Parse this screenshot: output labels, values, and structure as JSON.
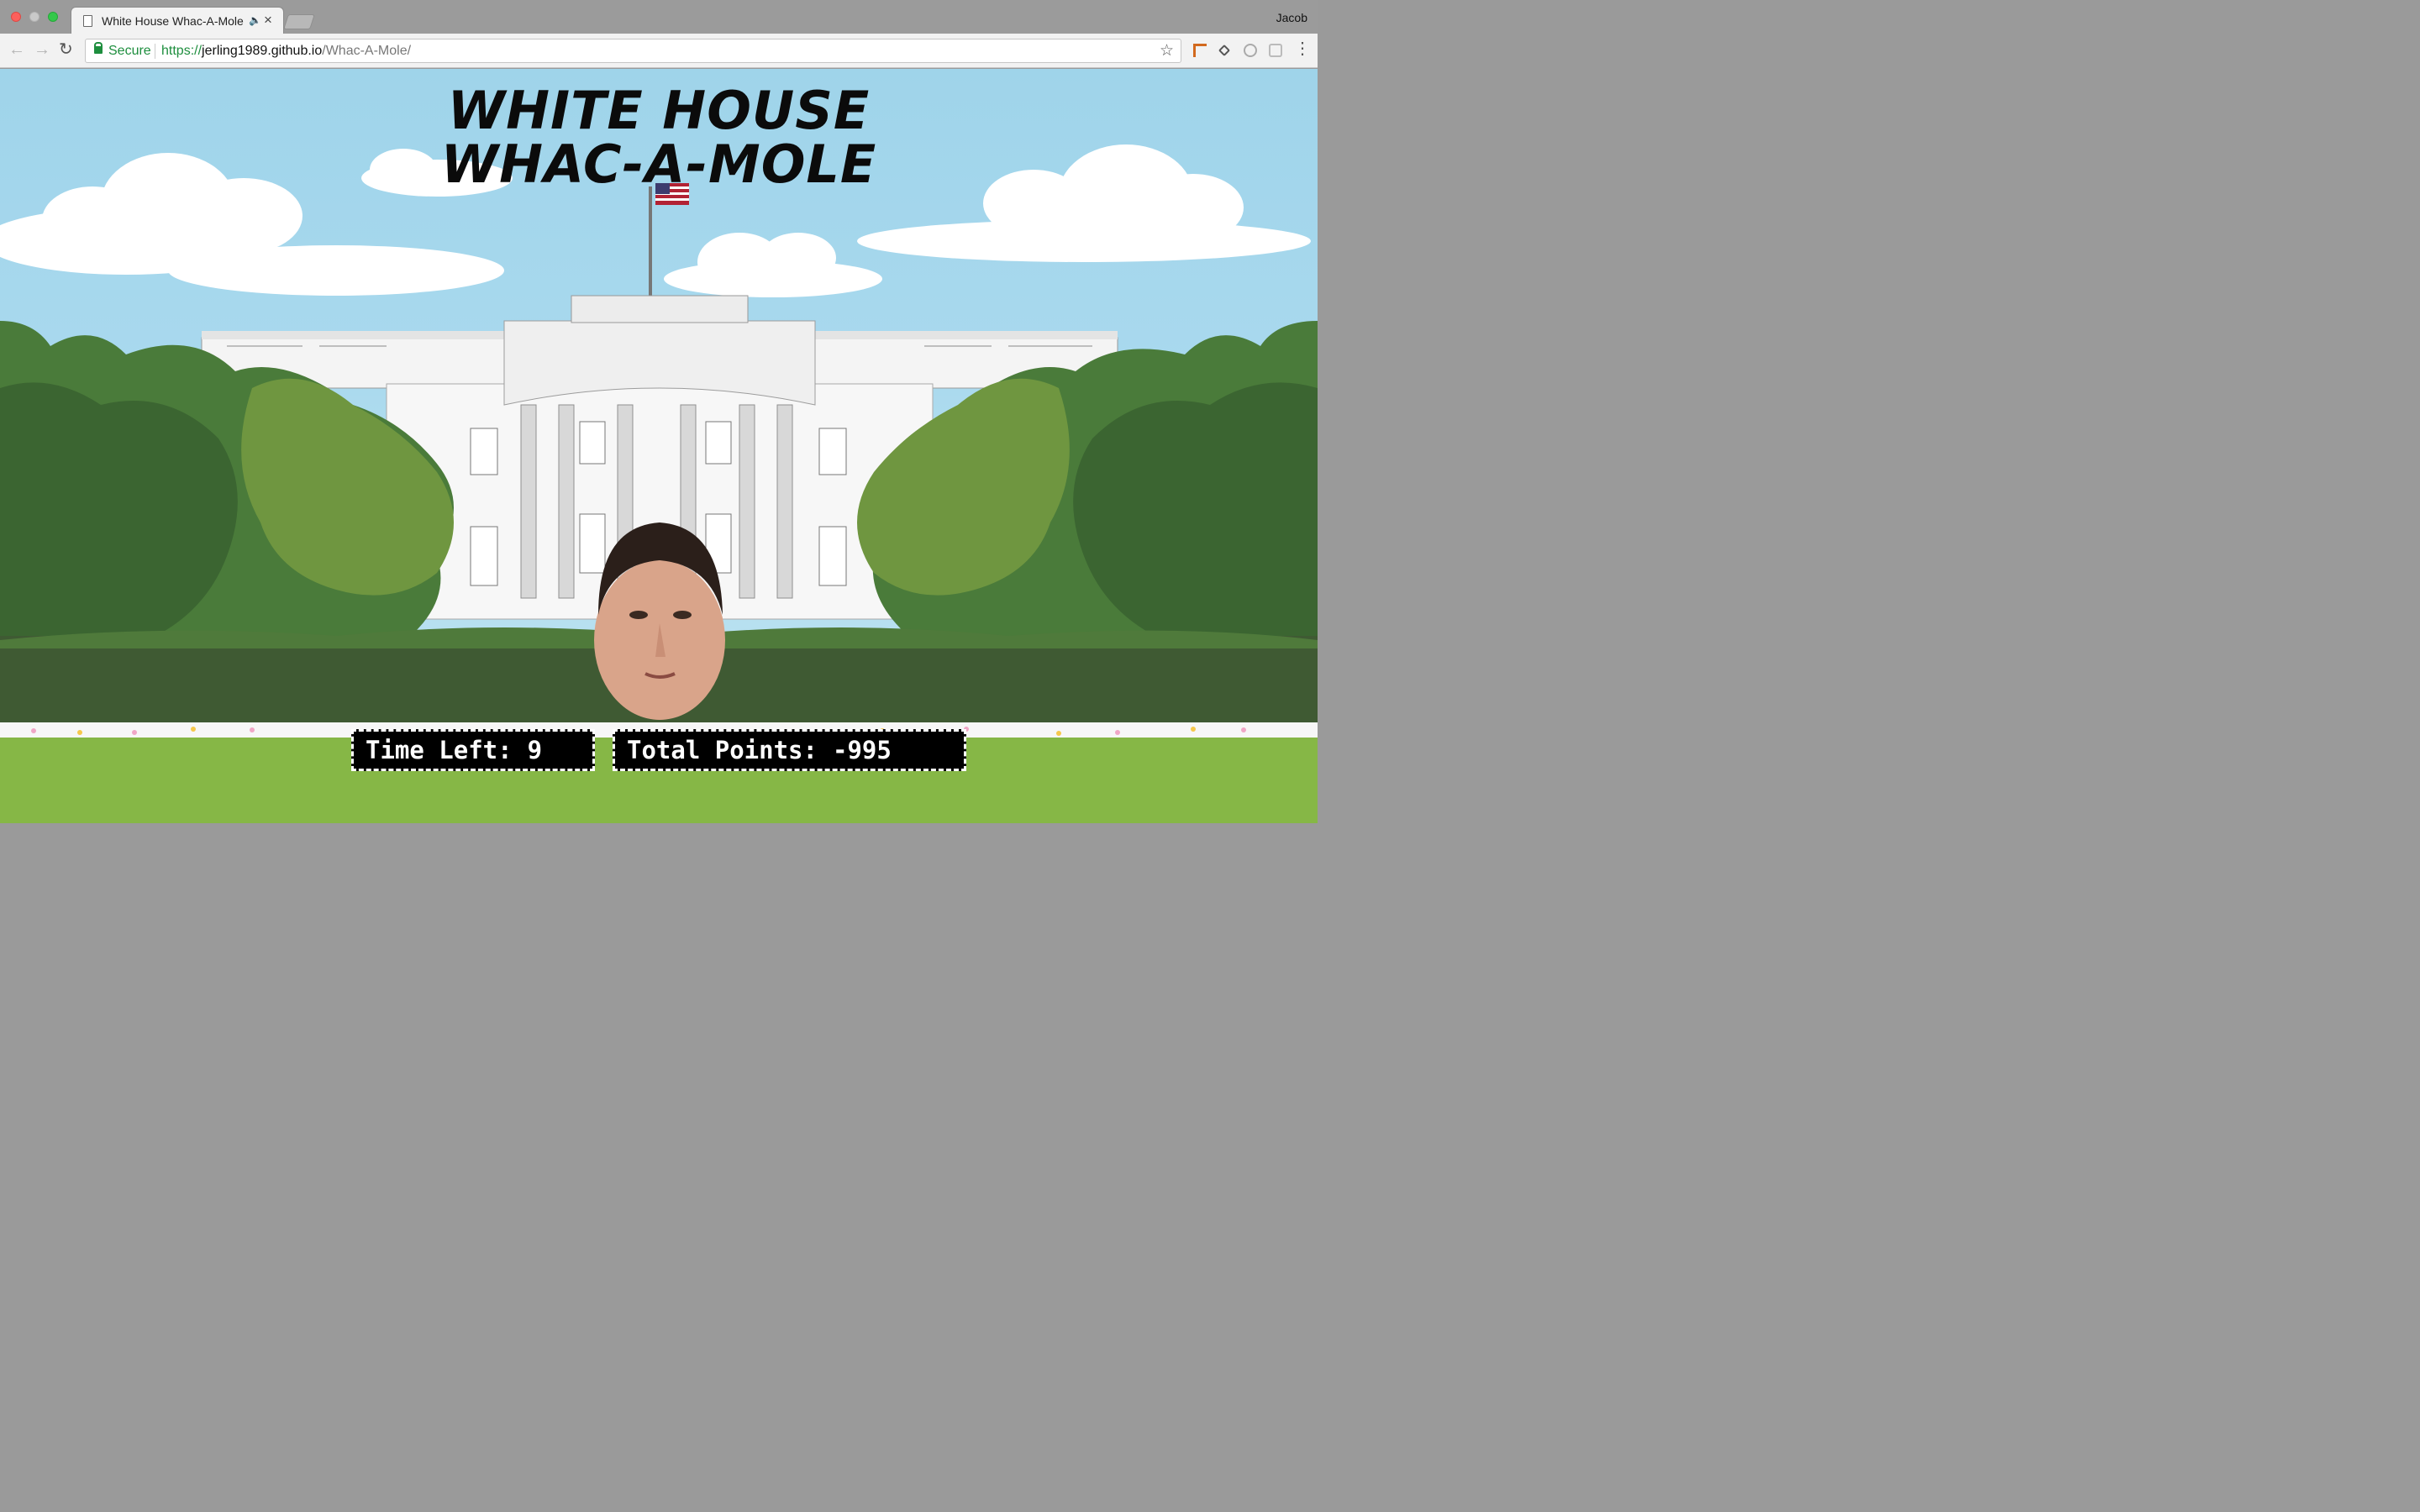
{
  "browser": {
    "tab_title": "White House Whac-A-Mole",
    "profile_name": "Jacob",
    "secure_label": "Secure",
    "url_scheme": "https://",
    "url_host": "jerling1989.github.io",
    "url_path": "/Whac-A-Mole/"
  },
  "game": {
    "title_line1": "WHITE HOUSE",
    "title_line2": "WHAC-A-MOLE",
    "time_label": "Time Left:",
    "time_value": "9",
    "points_label": "Total Points:",
    "points_value": "-995"
  },
  "colors": {
    "sky": "#a9d9ee",
    "hedge": "#3f5a33",
    "grass": "#8fbf48",
    "secure_green": "#1e8e3e",
    "hud_bg": "#000000",
    "hud_text": "#ffffff"
  },
  "icons": [
    "close-window-icon",
    "minimize-window-icon",
    "maximize-window-icon",
    "page-icon",
    "audio-icon",
    "tab-close-icon",
    "back-icon",
    "forward-icon",
    "reload-icon",
    "lock-icon",
    "star-icon",
    "menu-icon"
  ]
}
